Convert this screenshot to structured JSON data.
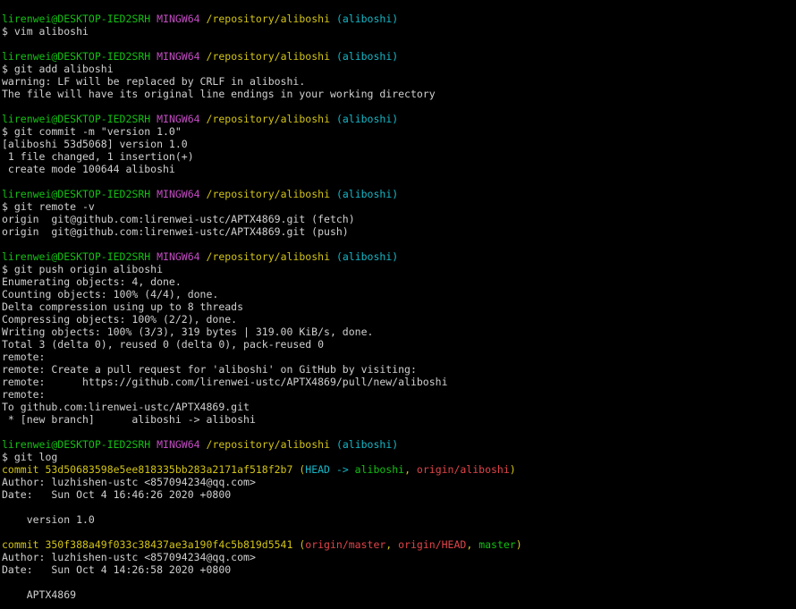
{
  "prompt": {
    "user_host": "lirenwei@DESKTOP-IED2SRH",
    "shell": "MINGW64",
    "path": "/repository/aliboshi",
    "branch": "(aliboshi)"
  },
  "lines": [
    {
      "kind": "prompt"
    },
    {
      "kind": "cmd",
      "segments": [
        {
          "text": "$ vim aliboshi",
          "color": "white"
        }
      ]
    },
    {
      "kind": "blank"
    },
    {
      "kind": "prompt"
    },
    {
      "kind": "cmd",
      "segments": [
        {
          "text": "$ git add aliboshi",
          "color": "white"
        }
      ]
    },
    {
      "kind": "out",
      "segments": [
        {
          "text": "warning: LF will be replaced by CRLF in aliboshi.",
          "color": "white"
        }
      ]
    },
    {
      "kind": "out",
      "segments": [
        {
          "text": "The file will have its original line endings in your working directory",
          "color": "white"
        }
      ]
    },
    {
      "kind": "blank"
    },
    {
      "kind": "prompt"
    },
    {
      "kind": "cmd",
      "segments": [
        {
          "text": "$ git commit -m \"version 1.0\"",
          "color": "white"
        }
      ]
    },
    {
      "kind": "out",
      "segments": [
        {
          "text": "[aliboshi 53d5068] version 1.0",
          "color": "white"
        }
      ]
    },
    {
      "kind": "out",
      "segments": [
        {
          "text": " 1 file changed, 1 insertion(+)",
          "color": "white"
        }
      ]
    },
    {
      "kind": "out",
      "segments": [
        {
          "text": " create mode 100644 aliboshi",
          "color": "white"
        }
      ]
    },
    {
      "kind": "blank"
    },
    {
      "kind": "prompt"
    },
    {
      "kind": "cmd",
      "segments": [
        {
          "text": "$ git remote -v",
          "color": "white"
        }
      ]
    },
    {
      "kind": "out",
      "segments": [
        {
          "text": "origin  git@github.com:lirenwei-ustc/APTX4869.git (fetch)",
          "color": "white"
        }
      ]
    },
    {
      "kind": "out",
      "segments": [
        {
          "text": "origin  git@github.com:lirenwei-ustc/APTX4869.git (push)",
          "color": "white"
        }
      ]
    },
    {
      "kind": "blank"
    },
    {
      "kind": "prompt"
    },
    {
      "kind": "cmd",
      "segments": [
        {
          "text": "$ git push origin aliboshi",
          "color": "white"
        }
      ]
    },
    {
      "kind": "out",
      "segments": [
        {
          "text": "Enumerating objects: 4, done.",
          "color": "white"
        }
      ]
    },
    {
      "kind": "out",
      "segments": [
        {
          "text": "Counting objects: 100% (4/4), done.",
          "color": "white"
        }
      ]
    },
    {
      "kind": "out",
      "segments": [
        {
          "text": "Delta compression using up to 8 threads",
          "color": "white"
        }
      ]
    },
    {
      "kind": "out",
      "segments": [
        {
          "text": "Compressing objects: 100% (2/2), done.",
          "color": "white"
        }
      ]
    },
    {
      "kind": "out",
      "segments": [
        {
          "text": "Writing objects: 100% (3/3), 319 bytes | 319.00 KiB/s, done.",
          "color": "white"
        }
      ]
    },
    {
      "kind": "out",
      "segments": [
        {
          "text": "Total 3 (delta 0), reused 0 (delta 0), pack-reused 0",
          "color": "white"
        }
      ]
    },
    {
      "kind": "out",
      "segments": [
        {
          "text": "remote:",
          "color": "white"
        }
      ]
    },
    {
      "kind": "out",
      "segments": [
        {
          "text": "remote: Create a pull request for 'aliboshi' on GitHub by visiting:",
          "color": "white"
        }
      ]
    },
    {
      "kind": "out",
      "segments": [
        {
          "text": "remote:      https://github.com/lirenwei-ustc/APTX4869/pull/new/aliboshi",
          "color": "white"
        }
      ]
    },
    {
      "kind": "out",
      "segments": [
        {
          "text": "remote:",
          "color": "white"
        }
      ]
    },
    {
      "kind": "out",
      "segments": [
        {
          "text": "To github.com:lirenwei-ustc/APTX4869.git",
          "color": "white"
        }
      ]
    },
    {
      "kind": "out",
      "segments": [
        {
          "text": " * [new branch]      aliboshi -> aliboshi",
          "color": "white"
        }
      ]
    },
    {
      "kind": "blank"
    },
    {
      "kind": "prompt"
    },
    {
      "kind": "cmd",
      "segments": [
        {
          "text": "$ git log",
          "color": "white"
        }
      ]
    },
    {
      "kind": "out",
      "segments": [
        {
          "text": "commit 53d50683598e5ee818335bb283a2171af518f2b7 ",
          "color": "yellow"
        },
        {
          "text": "(",
          "color": "yellow"
        },
        {
          "text": "HEAD -> ",
          "color": "cyan"
        },
        {
          "text": "aliboshi",
          "color": "green"
        },
        {
          "text": ", ",
          "color": "yellow"
        },
        {
          "text": "origin/aliboshi",
          "color": "red"
        },
        {
          "text": ")",
          "color": "yellow"
        }
      ]
    },
    {
      "kind": "out",
      "segments": [
        {
          "text": "Author: luzhishen-ustc <857094234@qq.com>",
          "color": "white"
        }
      ]
    },
    {
      "kind": "out",
      "segments": [
        {
          "text": "Date:   Sun Oct 4 16:46:26 2020 +0800",
          "color": "white"
        }
      ]
    },
    {
      "kind": "blank"
    },
    {
      "kind": "out",
      "segments": [
        {
          "text": "    version 1.0",
          "color": "white"
        }
      ]
    },
    {
      "kind": "blank"
    },
    {
      "kind": "out",
      "segments": [
        {
          "text": "commit 350f388a49f033c38437ae3a190f4c5b819d5541 ",
          "color": "yellow"
        },
        {
          "text": "(",
          "color": "yellow"
        },
        {
          "text": "origin/master",
          "color": "red"
        },
        {
          "text": ", ",
          "color": "yellow"
        },
        {
          "text": "origin/HEAD",
          "color": "red"
        },
        {
          "text": ", ",
          "color": "yellow"
        },
        {
          "text": "master",
          "color": "green"
        },
        {
          "text": ")",
          "color": "yellow"
        }
      ]
    },
    {
      "kind": "out",
      "segments": [
        {
          "text": "Author: luzhishen-ustc <857094234@qq.com>",
          "color": "white"
        }
      ]
    },
    {
      "kind": "out",
      "segments": [
        {
          "text": "Date:   Sun Oct 4 14:26:58 2020 +0800",
          "color": "white"
        }
      ]
    },
    {
      "kind": "blank"
    },
    {
      "kind": "out",
      "segments": [
        {
          "text": "    APTX4869",
          "color": "white"
        }
      ]
    }
  ],
  "colors": {
    "background": "#000000",
    "white": "#d0d0d0",
    "green": "#13c013",
    "magenta": "#c54cc5",
    "yellow": "#d2c417",
    "cyan": "#15b8c8",
    "red": "#e0444a"
  }
}
